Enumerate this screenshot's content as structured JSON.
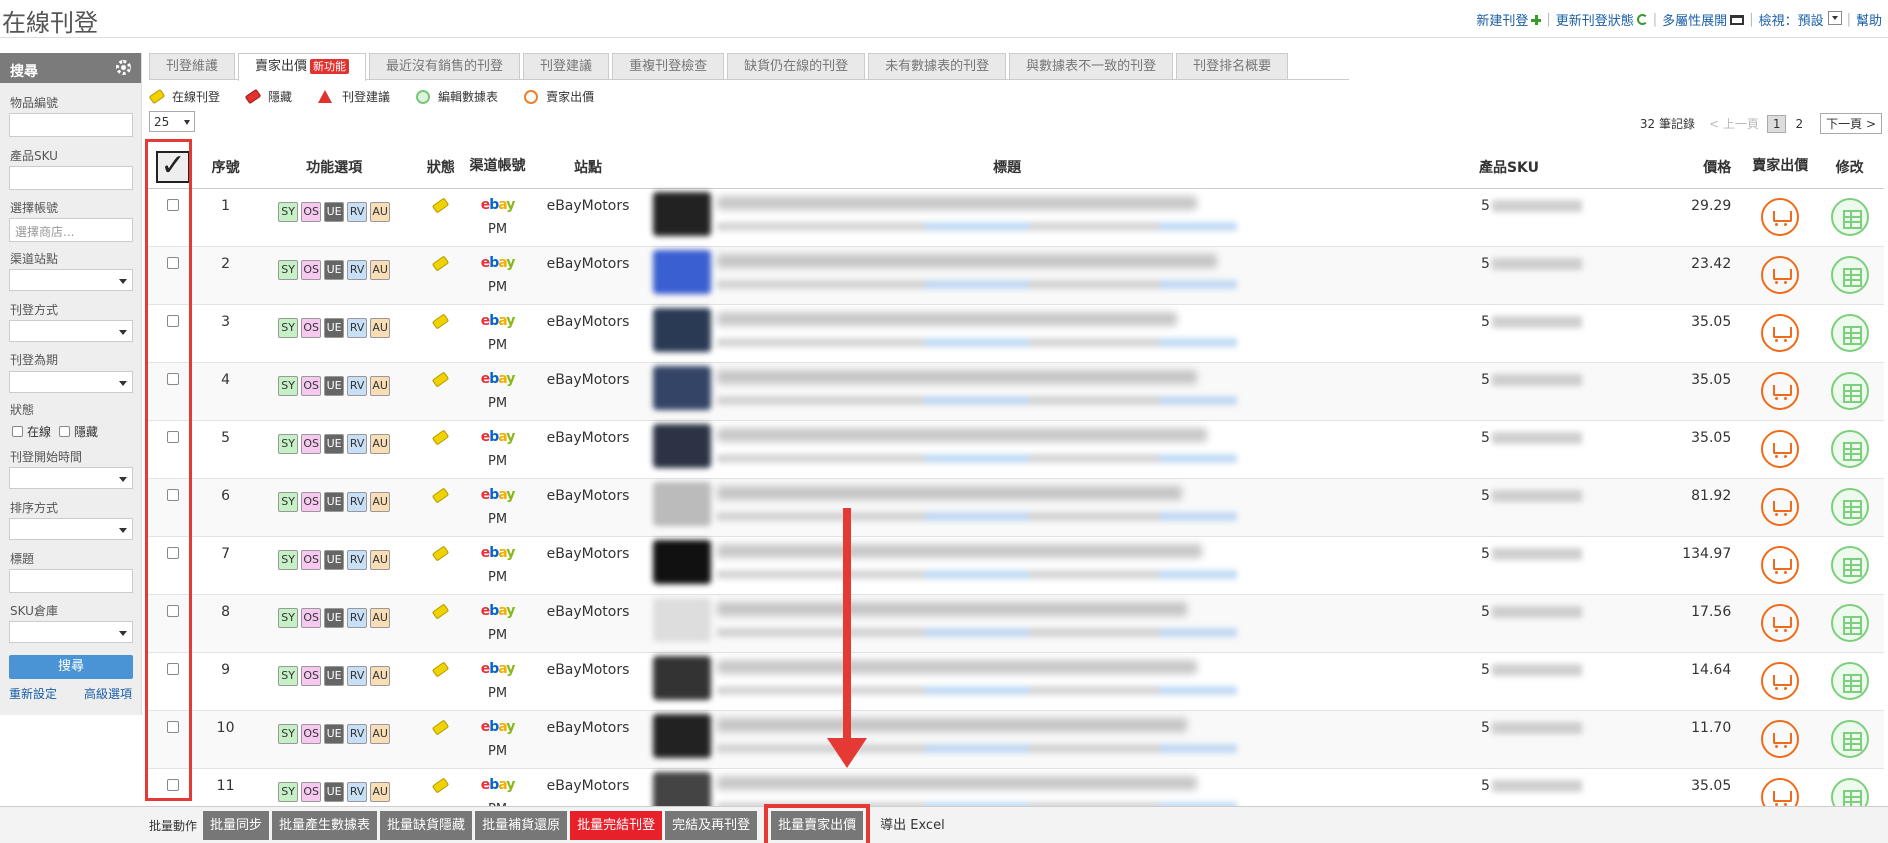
{
  "header": {
    "title": "在線刊登",
    "links": {
      "new_listing": "新建刊登",
      "update_status": "更新刊登狀態",
      "multi_attr": "多屬性展開",
      "view_label": "檢視：預設",
      "help": "幫助"
    }
  },
  "sidebar": {
    "title": "搜尋",
    "item_no_label": "物品編號",
    "sku_label": "產品SKU",
    "account_label": "選擇帳號",
    "account_placeholder": "選擇商店...",
    "channel_site_label": "渠道站點",
    "listing_type_label": "刊登方式",
    "duration_label": "刊登為期",
    "status_label": "狀態",
    "status_online": "在線",
    "status_hidden": "隱藏",
    "start_time_label": "刊登開始時間",
    "sort_label": "排序方式",
    "title_label": "標題",
    "warehouse_label": "SKU倉庫",
    "search_button": "搜尋",
    "reset_link": "重新設定",
    "advanced_link": "高級選項"
  },
  "tabs": [
    {
      "label": "刊登維護"
    },
    {
      "label": "賣家出價",
      "badge": "新功能"
    },
    {
      "label": "最近沒有銷售的刊登"
    },
    {
      "label": "刊登建議"
    },
    {
      "label": "重複刊登檢查"
    },
    {
      "label": "缺貨仍在線的刊登"
    },
    {
      "label": "未有數據表的刊登"
    },
    {
      "label": "與數據表不一致的刊登"
    },
    {
      "label": "刊登排名概要"
    }
  ],
  "legend": {
    "online": "在線刊登",
    "hidden": "隱藏",
    "suggestion": "刊登建議",
    "edit_data": "編輯數據表",
    "seller_offer": "賣家出價"
  },
  "per_page": "25",
  "pager": {
    "records": "32 筆記錄",
    "prev": "< 上一頁",
    "page1": "1",
    "page2": "2",
    "next": "下一頁 >"
  },
  "table": {
    "headers": {
      "no": "序號",
      "functions": "功能選項",
      "status": "狀態",
      "channel": "渠道帳號",
      "site": "站點",
      "title": "標題",
      "sku": "產品SKU",
      "price": "價格",
      "seller_offer": "賣家出價",
      "edit": "修改"
    },
    "fn_buttons": [
      "SY",
      "OS",
      "UE",
      "RV",
      "AU"
    ],
    "rows": [
      {
        "no": "1",
        "channel_account": "PM",
        "site": "eBayMotors",
        "sku_prefix": "5",
        "price": "29.29"
      },
      {
        "no": "2",
        "channel_account": "PM",
        "site": "eBayMotors",
        "sku_prefix": "5",
        "price": "23.42"
      },
      {
        "no": "3",
        "channel_account": "PM",
        "site": "eBayMotors",
        "sku_prefix": "5",
        "price": "35.05"
      },
      {
        "no": "4",
        "channel_account": "PM",
        "site": "eBayMotors",
        "sku_prefix": "5",
        "price": "35.05"
      },
      {
        "no": "5",
        "channel_account": "PM",
        "site": "eBayMotors",
        "sku_prefix": "5",
        "price": "35.05"
      },
      {
        "no": "6",
        "channel_account": "PM",
        "site": "eBayMotors",
        "sku_prefix": "5",
        "price": "81.92"
      },
      {
        "no": "7",
        "channel_account": "PM",
        "site": "eBayMotors",
        "sku_prefix": "5",
        "price": "134.97"
      },
      {
        "no": "8",
        "channel_account": "PM",
        "site": "eBayMotors",
        "sku_prefix": "5",
        "price": "17.56"
      },
      {
        "no": "9",
        "channel_account": "PM",
        "site": "eBayMotors",
        "sku_prefix": "5",
        "price": "14.64"
      },
      {
        "no": "10",
        "channel_account": "PM",
        "site": "eBayMotors",
        "sku_prefix": "5",
        "price": "11.70"
      },
      {
        "no": "11",
        "channel_account": "PM",
        "site": "eBayMotors",
        "sku_prefix": "5",
        "price": "35.05"
      }
    ]
  },
  "bulk": {
    "label": "批量動作",
    "sync": "批量同步",
    "gen_data": "批量產生數據表",
    "oos_hide": "批量缺貨隱藏",
    "restock": "批量補貨還原",
    "end": "批量完結刊登",
    "end_relist": "完結及再刊登",
    "seller_offer": "批量賣家出價",
    "export": "導出 Excel"
  },
  "colors": {
    "accent_red": "#e53935",
    "link_blue": "#1a5fa8",
    "search_blue": "#4a94d6"
  }
}
